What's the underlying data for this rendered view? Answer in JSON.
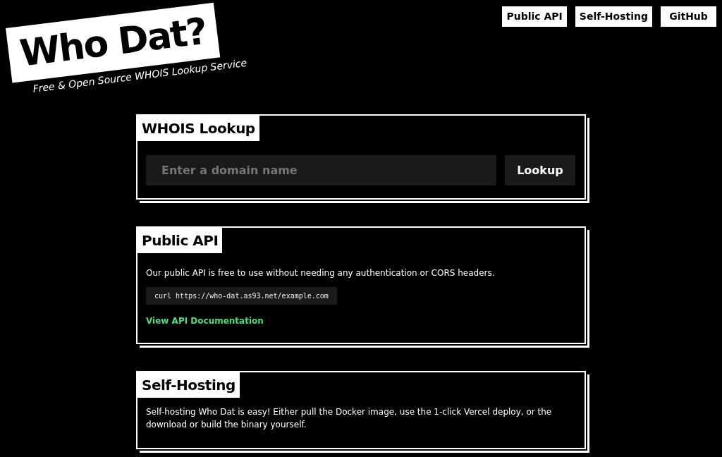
{
  "logo": {
    "title": "Who Dat?",
    "tagline": "Free & Open Source WHOIS Lookup Service"
  },
  "nav": [
    {
      "label": "Public API"
    },
    {
      "label": "Self-Hosting"
    },
    {
      "label": "GitHub"
    }
  ],
  "lookup": {
    "title": "WHOIS Lookup",
    "placeholder": "Enter a domain name",
    "button": "Lookup"
  },
  "public_api": {
    "title": "Public API",
    "text": "Our public API is free to use without needing any authentication or CORS headers.",
    "code": "curl https://who-dat.as93.net/example.com",
    "link": "View API Documentation"
  },
  "self_hosting": {
    "title": "Self-Hosting",
    "text": "Self-hosting Who Dat is easy! Either pull the Docker image, use the 1-click Vercel deploy, or the download or build the binary yourself."
  }
}
